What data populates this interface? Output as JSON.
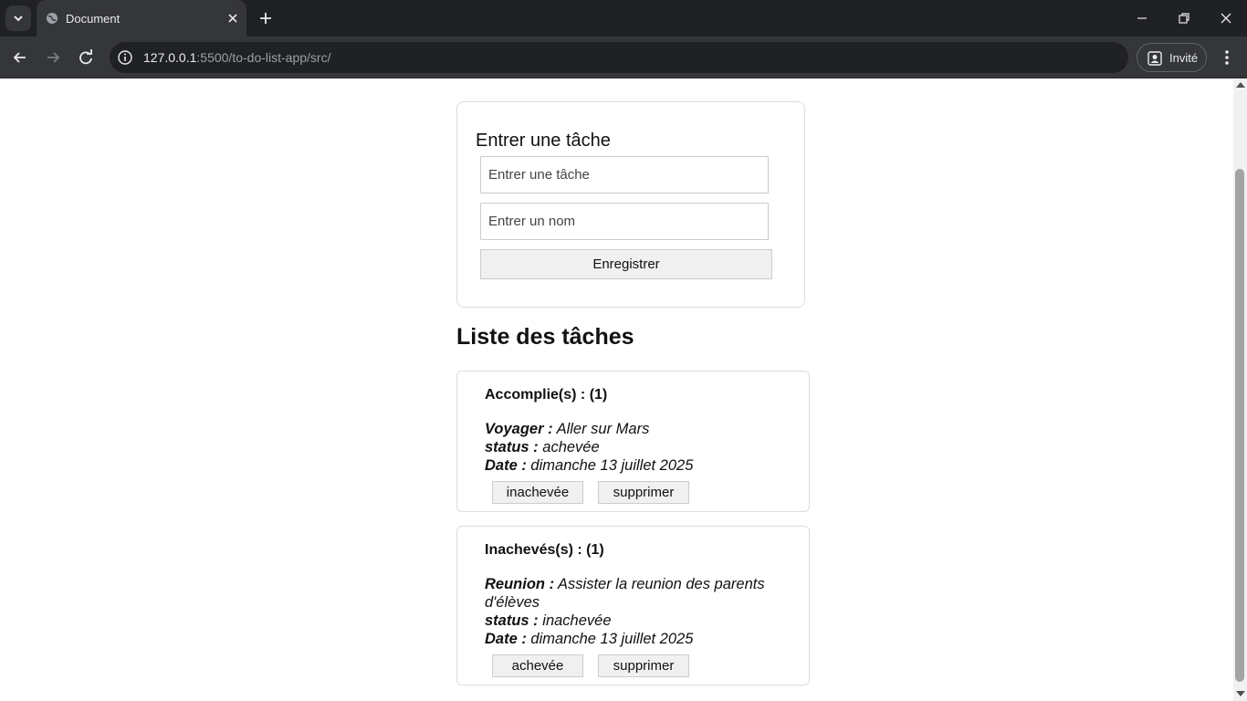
{
  "browser": {
    "tab_title": "Document",
    "url_host": "127.0.0.1",
    "url_path": ":5500/to-do-list-app/src/",
    "profile_label": "Invité"
  },
  "form": {
    "title": "Entrer une tâche",
    "task_placeholder": "Entrer une tâche",
    "name_placeholder": "Entrer un nom",
    "save_label": "Enregistrer"
  },
  "list": {
    "heading": "Liste des tâches",
    "done": {
      "title": "Accomplie(s) : (1)",
      "task_name": "Voyager :",
      "task_desc": " Aller sur Mars",
      "status_label": "status :",
      "status_value": " achevée",
      "date_label": "Date :",
      "date_value": " dimanche 13 juillet 2025",
      "toggle_label": "inachevée",
      "delete_label": "supprimer"
    },
    "todo": {
      "title": "Inachevés(s) : (1)",
      "task_name": "Reunion :",
      "task_desc": " Assister la reunion des parents d'élèves",
      "status_label": "status :",
      "status_value": " inachevée",
      "date_label": "Date :",
      "date_value": " dimanche 13 juillet 2025",
      "toggle_label": "achevée",
      "delete_label": "supprimer"
    }
  },
  "icons": {
    "tab_menu": "chevron-down-icon",
    "favicon": "globe-icon",
    "tab_close": "close-icon",
    "new_tab": "plus-icon",
    "back": "arrow-left-icon",
    "forward": "arrow-right-icon",
    "reload": "reload-icon",
    "site_info": "info-icon",
    "profile": "profile-icon",
    "menu": "kebab-icon"
  },
  "colors": {
    "chrome_dark": "#202124",
    "chrome_toolbar": "#35363a",
    "button_bg": "#f0f0f0",
    "card_border": "#dddddd"
  }
}
